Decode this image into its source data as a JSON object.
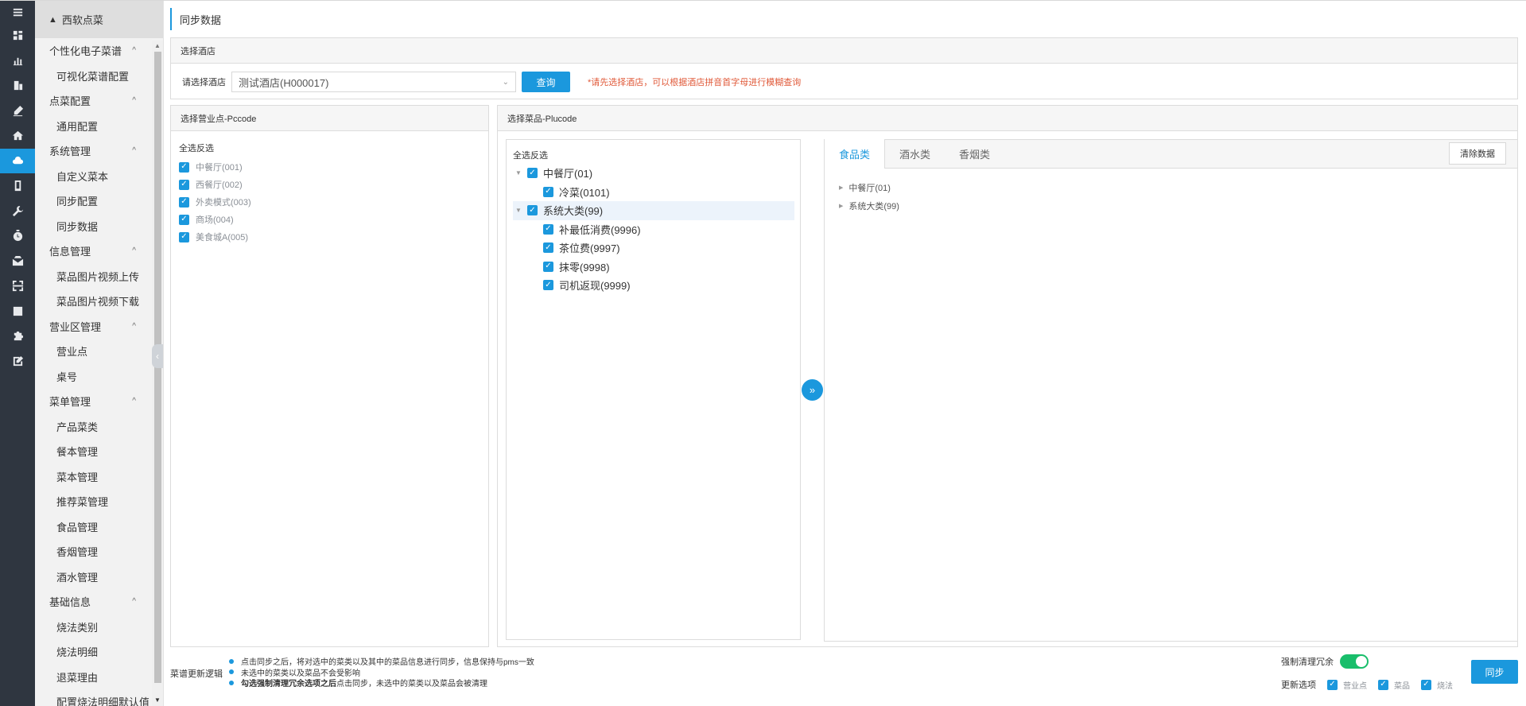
{
  "rail": {
    "icons": [
      "menu-icon",
      "dashboard-icon",
      "bar-chart-icon",
      "building-icon",
      "pen-icon",
      "home-icon",
      "cloud-icon",
      "tablet-icon",
      "wrench-icon",
      "timer-icon",
      "mail-icon",
      "scan-icon",
      "list-icon",
      "puzzle-icon",
      "edit-icon"
    ],
    "active_index": 6
  },
  "menu": {
    "header": "西软点菜",
    "groups": [
      {
        "label": "个性化电子菜谱",
        "items": [
          "可视化菜谱配置"
        ]
      },
      {
        "label": "点菜配置",
        "items": [
          "通用配置"
        ]
      },
      {
        "label": "系统管理",
        "items": [
          "自定义菜本",
          "同步配置",
          "同步数据"
        ]
      },
      {
        "label": "信息管理",
        "items": [
          "菜品图片视频上传",
          "菜品图片视频下载"
        ]
      },
      {
        "label": "营业区管理",
        "items": [
          "营业点",
          "桌号"
        ]
      },
      {
        "label": "菜单管理",
        "items": [
          "产品菜类",
          "餐本管理",
          "菜本管理",
          "推荐菜管理",
          "食品管理",
          "香烟管理",
          "酒水管理"
        ]
      },
      {
        "label": "基础信息",
        "items": [
          "烧法类别",
          "烧法明细",
          "退菜理由",
          "配置烧法明细默认值"
        ]
      }
    ]
  },
  "page": {
    "title": "同步数据"
  },
  "hotel": {
    "panel_title": "选择酒店",
    "label": "请选择酒店",
    "selected": "测试酒店(H000017)",
    "query_label": "查询",
    "hint": "*请先选择酒店，可以根据酒店拼音首字母进行模糊查询"
  },
  "pccode": {
    "panel_title": "选择营业点-Pccode",
    "select_all": "全选反选",
    "items": [
      "中餐厅(001)",
      "西餐厅(002)",
      "外卖模式(003)",
      "商场(004)",
      "美食城A(005)"
    ]
  },
  "plucode": {
    "panel_title": "选择菜品-Plucode",
    "select_all": "全选反选",
    "tree": [
      {
        "label": "中餐厅(01)",
        "children": [
          "冷菜(0101)"
        ]
      },
      {
        "label": "系统大类(99)",
        "children": [
          "补最低消费(9996)",
          "茶位费(9997)",
          "抹零(9998)",
          "司机返现(9999)"
        ]
      }
    ],
    "move_icon": "double-chevron-right-icon"
  },
  "result": {
    "tabs": [
      "食品类",
      "酒水类",
      "香烟类"
    ],
    "active_tab": 0,
    "clear_label": "清除数据",
    "tree": [
      "中餐厅(01)",
      "系统大类(99)"
    ]
  },
  "footer": {
    "logic_title": "菜谱更新逻辑",
    "logic_items": [
      {
        "bold": "",
        "text": "点击同步之后，将对选中的菜类以及其中的菜品信息进行同步，信息保持与pms一致"
      },
      {
        "bold": "",
        "text": "未选中的菜类以及菜品不会受影响"
      },
      {
        "bold": "勾选强制清理冗余选项之后",
        "text": "点击同步，未选中的菜类以及菜品会被清理"
      }
    ],
    "force_label": "强制清理冗余",
    "force_on": true,
    "update_label": "更新选项",
    "update_options": [
      "营业点",
      "菜品",
      "烧法"
    ],
    "sync_label": "同步"
  },
  "colors": {
    "accent": "#1b98dd",
    "rail": "#2f3640",
    "hint": "#e05a3a",
    "toggle": "#19be6b"
  }
}
